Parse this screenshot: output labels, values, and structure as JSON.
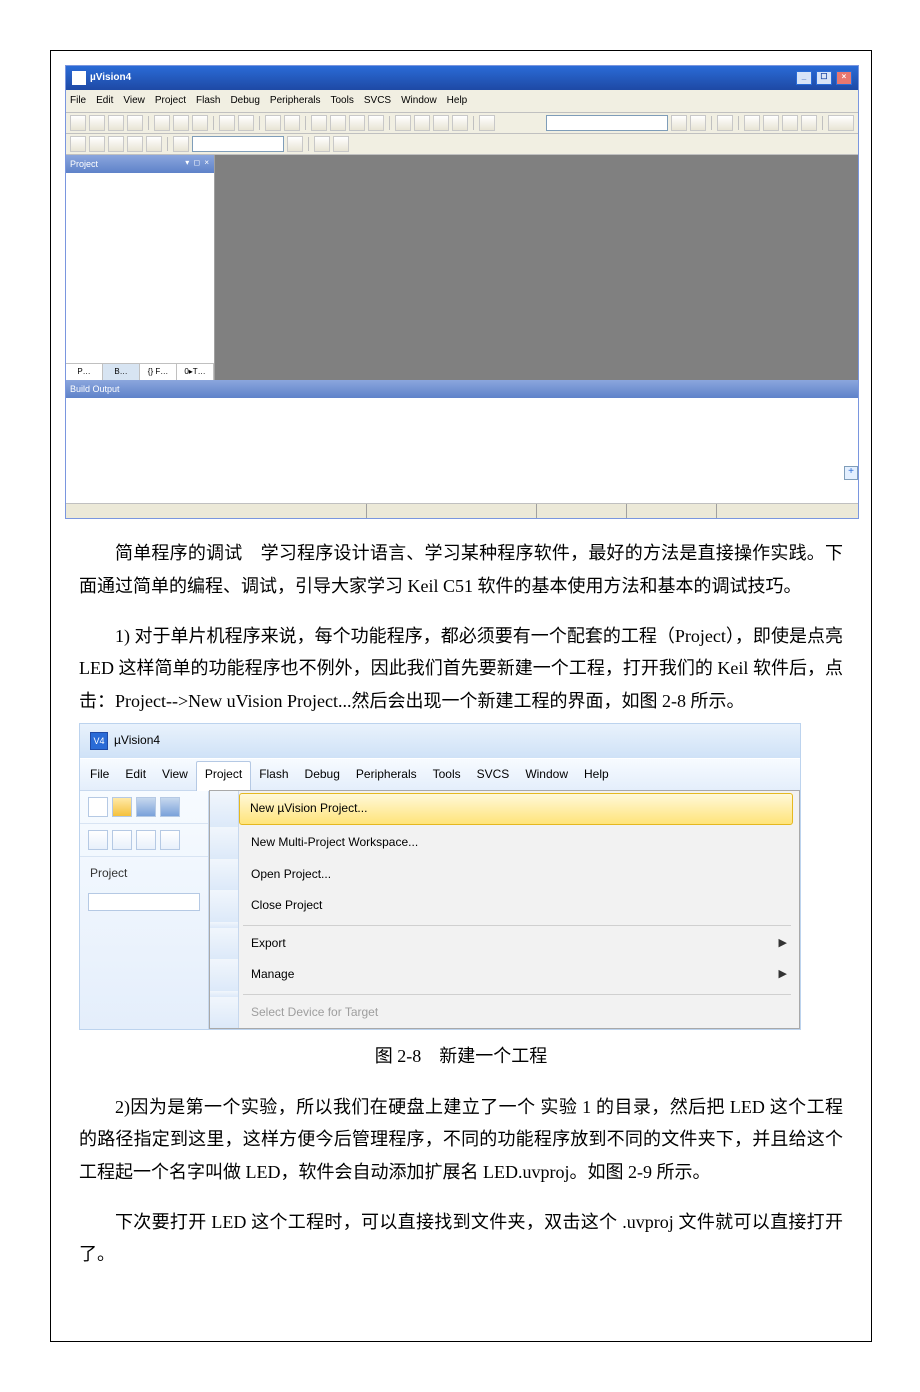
{
  "screenshot1": {
    "title": "µVision4",
    "menus": [
      "File",
      "Edit",
      "View",
      "Project",
      "Flash",
      "Debug",
      "Peripherals",
      "Tools",
      "SVCS",
      "Window",
      "Help"
    ],
    "project_pane": "Project",
    "project_pane_ctl": "▾ ◻ ×",
    "tabs": [
      "P…",
      "B…",
      "{} F…",
      "0▸T…"
    ],
    "build_output": "Build Output"
  },
  "para1": "简单程序的调试　学习程序设计语言、学习某种程序软件，最好的方法是直接操作实践。下面通过简单的编程、调试，引导大家学习 Keil C51 软件的基本使用方法和基本的调试技巧。",
  "para2": "1) 对于单片机程序来说，每个功能程序，都必须要有一个配套的工程（Project），即使是点亮 LED 这样简单的功能程序也不例外，因此我们首先要新建一个工程，打开我们的 Keil 软件后，点击：Project-->New uVision Project...然后会出现一个新建工程的界面，如图 2-8 所示。",
  "screenshot2": {
    "title": "µVision4",
    "menus": [
      "File",
      "Edit",
      "View",
      "Project",
      "Flash",
      "Debug",
      "Peripherals",
      "Tools",
      "SVCS",
      "Window",
      "Help"
    ],
    "side_label": "Project",
    "items": {
      "new": "New µVision Project...",
      "multi": "New Multi-Project Workspace...",
      "open": "Open Project...",
      "close": "Close Project",
      "export": "Export",
      "manage": "Manage",
      "select": "Select Device for Target"
    }
  },
  "caption": "图 2-8　新建一个工程",
  "para3": "2)因为是第一个实验，所以我们在硬盘上建立了一个 实验 1 的目录，然后把 LED 这个工程的路径指定到这里，这样方便今后管理程序，不同的功能程序放到不同的文件夹下，并且给这个工程起一个名字叫做 LED，软件会自动添加扩展名 LED.uvproj。如图 2-9 所示。",
  "para4": "下次要打开 LED 这个工程时，可以直接找到文件夹，双击这个 .uvproj 文件就可以直接打开了。"
}
